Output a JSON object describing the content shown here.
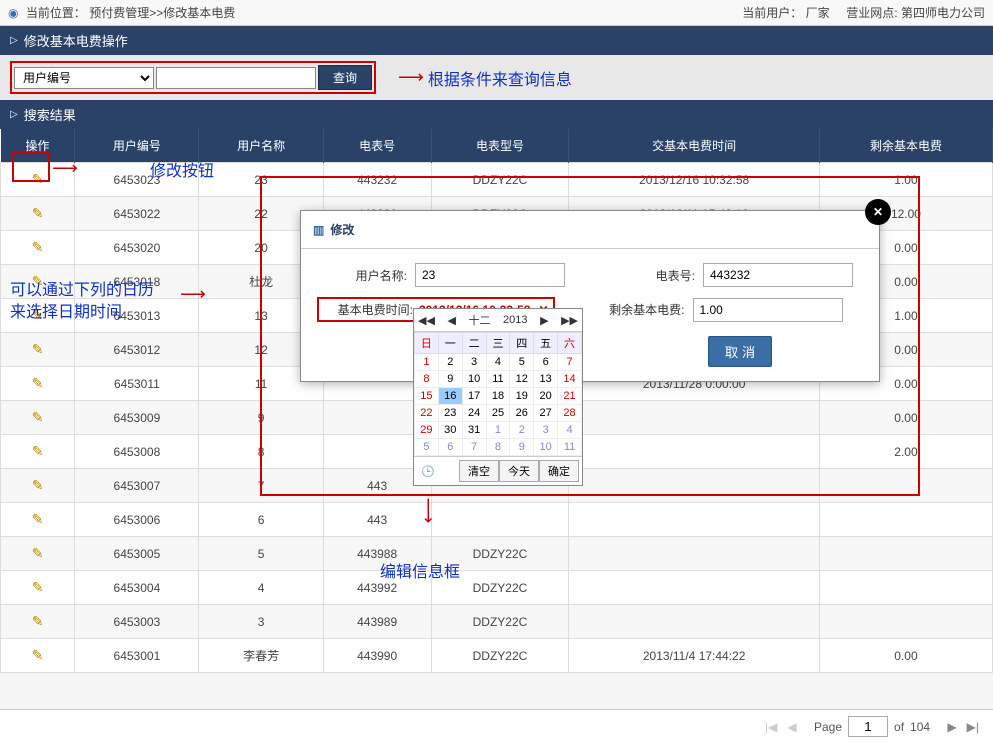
{
  "topbar": {
    "location_prefix": "当前位置：",
    "location_path": "预付费管理>>修改基本电费",
    "user_label": "当前用户：",
    "user_value": "厂家",
    "branch_label": "营业网点:",
    "branch_value": "第四师电力公司"
  },
  "panels": {
    "search_title": "修改基本电费操作",
    "results_title": "搜索结果"
  },
  "search": {
    "field_options": [
      "用户编号"
    ],
    "field_selected": "用户编号",
    "input_value": "",
    "query_btn": "查询"
  },
  "annotations": {
    "query_hint": "根据条件来查询信息",
    "edit_btn_hint": "修改按钮",
    "calendar_hint_l1": "可以通过下列的日历",
    "calendar_hint_l2": "来选择日期时间",
    "dialog_hint": "编辑信息框"
  },
  "columns": [
    "操作",
    "用户编号",
    "用户名称",
    "电表号",
    "电表型号",
    "交基本电费时间",
    "剩余基本电费"
  ],
  "rows": [
    {
      "id": "6453023",
      "name": "23",
      "meter": "443232",
      "model": "DDZY22C",
      "time": "2013/12/16 10:32:58",
      "bal": "1.00"
    },
    {
      "id": "6453022",
      "name": "22",
      "meter": "443239",
      "model": "DDZY22C",
      "time": "2013/12/11 15:43:16",
      "bal": "12.00"
    },
    {
      "id": "6453020",
      "name": "20",
      "meter": "",
      "model": "",
      "time": "",
      "bal": "0.00"
    },
    {
      "id": "6453018",
      "name": "杜龙",
      "meter": "",
      "model": "",
      "time": "",
      "bal": "0.00"
    },
    {
      "id": "6453013",
      "name": "13",
      "meter": "",
      "model": "",
      "time": "",
      "bal": "1.00"
    },
    {
      "id": "6453012",
      "name": "12",
      "meter": "",
      "model": "",
      "time": "",
      "bal": "0.00"
    },
    {
      "id": "6453011",
      "name": "11",
      "meter": "",
      "model": "",
      "time": "2013/11/28 0:00:00",
      "bal": "0.00"
    },
    {
      "id": "6453009",
      "name": "9",
      "meter": "",
      "model": "",
      "time": "",
      "bal": "0.00"
    },
    {
      "id": "6453008",
      "name": "8",
      "meter": "",
      "model": "",
      "time": "",
      "bal": "2.00"
    },
    {
      "id": "6453007",
      "name": "7",
      "meter": "443",
      "model": "",
      "time": "",
      "bal": ""
    },
    {
      "id": "6453006",
      "name": "6",
      "meter": "443",
      "model": "",
      "time": "",
      "bal": ""
    },
    {
      "id": "6453005",
      "name": "5",
      "meter": "443988",
      "model": "DDZY22C",
      "time": "",
      "bal": ""
    },
    {
      "id": "6453004",
      "name": "4",
      "meter": "443992",
      "model": "DDZY22C",
      "time": "",
      "bal": ""
    },
    {
      "id": "6453003",
      "name": "3",
      "meter": "443989",
      "model": "DDZY22C",
      "time": "",
      "bal": ""
    },
    {
      "id": "6453001",
      "name": "李春芳",
      "meter": "443990",
      "model": "DDZY22C",
      "time": "2013/11/4 17:44:22",
      "bal": "0.00"
    }
  ],
  "dialog": {
    "title": "修改",
    "lbl_username": "用户名称:",
    "val_username": "23",
    "lbl_meter": "电表号:",
    "val_meter": "443232",
    "lbl_feetime": "基本电费时间:",
    "val_feetime": "2013/12/16 10:32:58",
    "lbl_balance": "剩余基本电费:",
    "val_balance": "1.00",
    "cancel_btn": "取 消"
  },
  "calendar": {
    "month": "十二",
    "year": "2013",
    "weekdays": [
      "日",
      "一",
      "二",
      "三",
      "四",
      "五",
      "六"
    ],
    "grid": [
      [
        {
          "d": "1",
          "c": "sun"
        },
        {
          "d": "2"
        },
        {
          "d": "3"
        },
        {
          "d": "4"
        },
        {
          "d": "5"
        },
        {
          "d": "6"
        },
        {
          "d": "7",
          "c": "sat"
        }
      ],
      [
        {
          "d": "8",
          "c": "sun"
        },
        {
          "d": "9"
        },
        {
          "d": "10"
        },
        {
          "d": "11"
        },
        {
          "d": "12"
        },
        {
          "d": "13"
        },
        {
          "d": "14",
          "c": "sat"
        }
      ],
      [
        {
          "d": "15",
          "c": "sun"
        },
        {
          "d": "16",
          "c": "sel"
        },
        {
          "d": "17"
        },
        {
          "d": "18"
        },
        {
          "d": "19"
        },
        {
          "d": "20"
        },
        {
          "d": "21",
          "c": "sat"
        }
      ],
      [
        {
          "d": "22",
          "c": "sun"
        },
        {
          "d": "23"
        },
        {
          "d": "24"
        },
        {
          "d": "25"
        },
        {
          "d": "26"
        },
        {
          "d": "27"
        },
        {
          "d": "28",
          "c": "sat"
        }
      ],
      [
        {
          "d": "29",
          "c": "sun"
        },
        {
          "d": "30"
        },
        {
          "d": "31"
        },
        {
          "d": "1",
          "c": "other"
        },
        {
          "d": "2",
          "c": "other"
        },
        {
          "d": "3",
          "c": "other"
        },
        {
          "d": "4",
          "c": "other"
        }
      ],
      [
        {
          "d": "5",
          "c": "other"
        },
        {
          "d": "6",
          "c": "other"
        },
        {
          "d": "7",
          "c": "other"
        },
        {
          "d": "8",
          "c": "other"
        },
        {
          "d": "9",
          "c": "other"
        },
        {
          "d": "10",
          "c": "other"
        },
        {
          "d": "11",
          "c": "other"
        }
      ]
    ],
    "btn_clear": "清空",
    "btn_today": "今天",
    "btn_ok": "确定"
  },
  "pager": {
    "page_label": "Page",
    "page_value": "1",
    "of_label": "of",
    "total": "104"
  }
}
